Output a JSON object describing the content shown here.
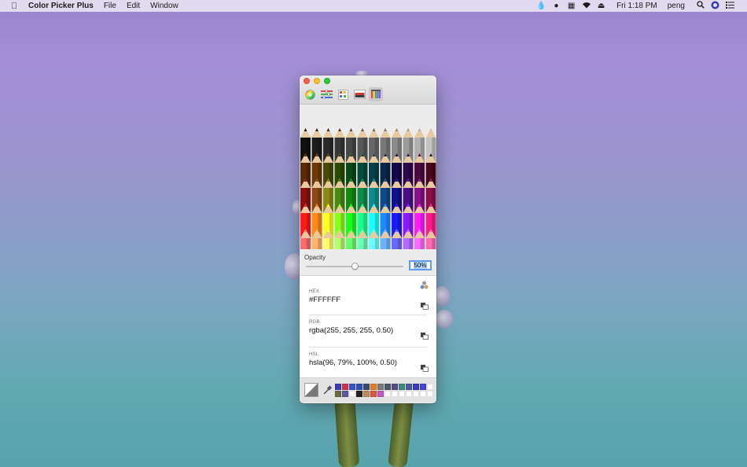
{
  "menubar": {
    "app": "Color Picker Plus",
    "menus": [
      "File",
      "Edit",
      "Window"
    ],
    "clock": "Fri 1:18 PM",
    "user": "peng"
  },
  "picker": {
    "opacity_label": "Opacity",
    "opacity_value": "50%",
    "opacity_fraction": 0.5,
    "hex_label": "HEX",
    "hex_value": "#FFFFFF",
    "rgb_label": "RGB",
    "rgb_value": "rgba(255, 255, 255, 0.50)",
    "hsl_label": "HSL",
    "hsl_value": "hsla(96, 79%, 100%, 0.50)"
  },
  "modes": [
    "color-wheel-icon",
    "sliders-icon",
    "palettes-icon",
    "image-palette-icon",
    "pencils-icon"
  ],
  "pencil_rows": [
    [
      "#111111",
      "#1c1c1c",
      "#2a2a2a",
      "#383838",
      "#474747",
      "#575757",
      "#676767",
      "#787878",
      "#8a8a8a",
      "#9c9c9c",
      "#b0b0b0",
      "#c4c4c4"
    ],
    [
      "#5a2a08",
      "#6b3a08",
      "#4a4a08",
      "#2a4a08",
      "#084a1a",
      "#084a3a",
      "#08404a",
      "#08284a",
      "#14084a",
      "#30084a",
      "#4a0840",
      "#4a0820"
    ],
    [
      "#8a1010",
      "#8a4a10",
      "#8a8a10",
      "#4a8a10",
      "#108a10",
      "#108a4a",
      "#108a8a",
      "#104a8a",
      "#10108a",
      "#4a108a",
      "#8a108a",
      "#8a104a"
    ],
    [
      "#ff1a1a",
      "#ff8a1a",
      "#ffff1a",
      "#8aff1a",
      "#1aff1a",
      "#1aff8a",
      "#1affff",
      "#1a8aff",
      "#1a1aff",
      "#8a1aff",
      "#ff1aff",
      "#ff1a8a"
    ],
    [
      "#ff6a6a",
      "#ffb46a",
      "#ffff6a",
      "#b4ff6a",
      "#6aff6a",
      "#6affb4",
      "#6affff",
      "#6ab4ff",
      "#6a6aff",
      "#b46aff",
      "#ff6aff",
      "#ff6ab4"
    ]
  ],
  "swatches": [
    "#3b3bb0",
    "#d3304a",
    "#3556c8",
    "#2f4cc0",
    "#3a4a6a",
    "#e37b1f",
    "#7a7a7a",
    "#4a5a6a",
    "#5a4a8a",
    "#3a8a7a",
    "#4a5a9a",
    "#3a3ac0",
    "#4444cc",
    "#ffffff",
    "#6a6a3a",
    "#5a5aa0",
    "#ffffff",
    "#222222",
    "#c08a5a",
    "#e2553a",
    "#c05ac0",
    "#ffffff",
    "#ffffff",
    "#ffffff",
    "#ffffff",
    "#ffffff",
    "#ffffff",
    "#ffffff"
  ]
}
